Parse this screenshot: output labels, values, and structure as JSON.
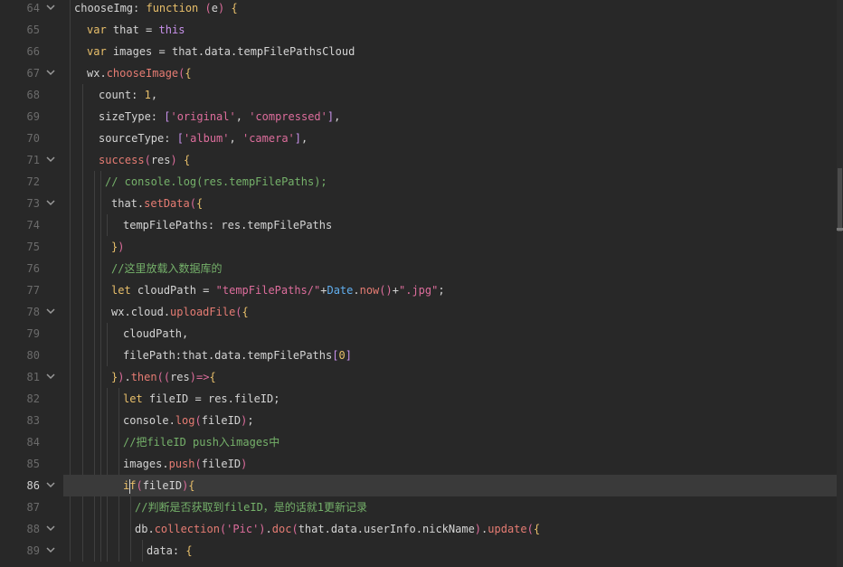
{
  "editor": {
    "active_line": "86",
    "lines": [
      {
        "n": "64",
        "text": "chooseImg: function (e) {",
        "fold": true
      },
      {
        "n": "65",
        "text": "var that = this",
        "fold": false
      },
      {
        "n": "66",
        "text": "var images = that.data.tempFilePathsCloud",
        "fold": false
      },
      {
        "n": "67",
        "text": "wx.chooseImage({",
        "fold": true
      },
      {
        "n": "68",
        "text": "count: 1,",
        "fold": false
      },
      {
        "n": "69",
        "text": "sizeType: ['original', 'compressed'],",
        "fold": false
      },
      {
        "n": "70",
        "text": "sourceType: ['album', 'camera'],",
        "fold": false
      },
      {
        "n": "71",
        "text": "success(res) {",
        "fold": true
      },
      {
        "n": "72",
        "text": "// console.log(res.tempFilePaths);",
        "fold": false
      },
      {
        "n": "73",
        "text": "that.setData({",
        "fold": true
      },
      {
        "n": "74",
        "text": "tempFilePaths: res.tempFilePaths",
        "fold": false
      },
      {
        "n": "75",
        "text": "})",
        "fold": false
      },
      {
        "n": "76",
        "text": "//这里放载入数据库的",
        "fold": false
      },
      {
        "n": "77",
        "text": "let cloudPath = \"tempFilePaths/\"+Date.now()+\".jpg\";",
        "fold": false
      },
      {
        "n": "78",
        "text": "wx.cloud.uploadFile({",
        "fold": true
      },
      {
        "n": "79",
        "text": "cloudPath,",
        "fold": false
      },
      {
        "n": "80",
        "text": "filePath:that.data.tempFilePaths[0]",
        "fold": false
      },
      {
        "n": "81",
        "text": "}).then((res)=>{",
        "fold": true
      },
      {
        "n": "82",
        "text": "let fileID = res.fileID;",
        "fold": false
      },
      {
        "n": "83",
        "text": "console.log(fileID);",
        "fold": false
      },
      {
        "n": "84",
        "text": "//把fileID push入images中",
        "fold": false
      },
      {
        "n": "85",
        "text": "images.push(fileID)",
        "fold": false
      },
      {
        "n": "86",
        "text": "if(fileID){",
        "fold": true
      },
      {
        "n": "87",
        "text": "//判断是否获取到fileID，是的话就1更新记录",
        "fold": false
      },
      {
        "n": "88",
        "text": "db.collection('Pic').doc(that.data.userInfo.nickName).update({",
        "fold": true
      },
      {
        "n": "89",
        "text": "data: {",
        "fold": true
      }
    ]
  }
}
